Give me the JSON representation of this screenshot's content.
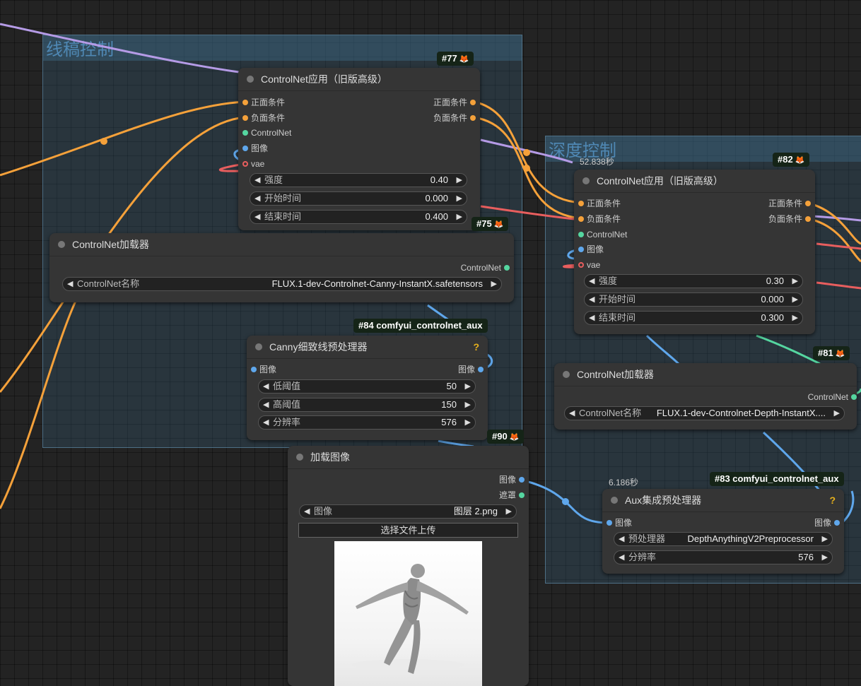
{
  "groups": {
    "lineart": {
      "title": "线稿控制"
    },
    "depth": {
      "title": "深度控制"
    }
  },
  "nodes": {
    "n77": {
      "badge": "#77",
      "title": "ControlNet应用（旧版高级）",
      "inputs": [
        "正面条件",
        "负面条件",
        "ControlNet",
        "图像",
        "vae"
      ],
      "outputs": [
        "正面条件",
        "负面条件"
      ],
      "widgets": [
        {
          "label": "强度",
          "value": "0.40"
        },
        {
          "label": "开始时间",
          "value": "0.000"
        },
        {
          "label": "结束时间",
          "value": "0.400"
        }
      ]
    },
    "n75": {
      "badge": "#75",
      "title": "ControlNet加载器",
      "output": "ControlNet",
      "widget": {
        "label": "ControlNet名称",
        "value": "FLUX.1-dev-Controlnet-Canny-InstantX.safetensors"
      }
    },
    "n84": {
      "badge": "#84 comfyui_controlnet_aux",
      "title": "Canny细致线预处理器",
      "input": "图像",
      "output": "图像",
      "widgets": [
        {
          "label": "低阈值",
          "value": "50"
        },
        {
          "label": "高阈值",
          "value": "150"
        },
        {
          "label": "分辨率",
          "value": "576"
        }
      ]
    },
    "n90": {
      "badge": "#90",
      "title": "加载图像",
      "outputs": [
        "图像",
        "遮罩"
      ],
      "widget": {
        "label": "图像",
        "value": "图层 2.png"
      },
      "upload_label": "选择文件上传"
    },
    "n82": {
      "badge": "#82",
      "timer": "52.838秒",
      "title": "ControlNet应用（旧版高级）",
      "inputs": [
        "正面条件",
        "负面条件",
        "ControlNet",
        "图像",
        "vae"
      ],
      "outputs": [
        "正面条件",
        "负面条件"
      ],
      "widgets": [
        {
          "label": "强度",
          "value": "0.30"
        },
        {
          "label": "开始时间",
          "value": "0.000"
        },
        {
          "label": "结束时间",
          "value": "0.300"
        }
      ]
    },
    "n81": {
      "badge": "#81",
      "title": "ControlNet加载器",
      "output": "ControlNet",
      "widget": {
        "label": "ControlNet名称",
        "value": "FLUX.1-dev-Controlnet-Depth-InstantX...."
      }
    },
    "n83": {
      "badge": "#83 comfyui_controlnet_aux",
      "timer": "6.186秒",
      "title": "Aux集成预处理器",
      "input": "图像",
      "output": "图像",
      "widgets": [
        {
          "label": "预处理器",
          "value": "DepthAnythingV2Preprocessor"
        },
        {
          "label": "分辨率",
          "value": "576"
        }
      ]
    }
  },
  "icons": {
    "fox": "fox-icon",
    "help": "question-mark-icon",
    "arrow_left": "◀",
    "arrow_right": "▶"
  },
  "colors": {
    "conditioning": "#f5a13a",
    "controlnet": "#55d6a0",
    "image": "#5fa7ec",
    "vae": "#e85e5e",
    "clip": "#b59be6"
  }
}
